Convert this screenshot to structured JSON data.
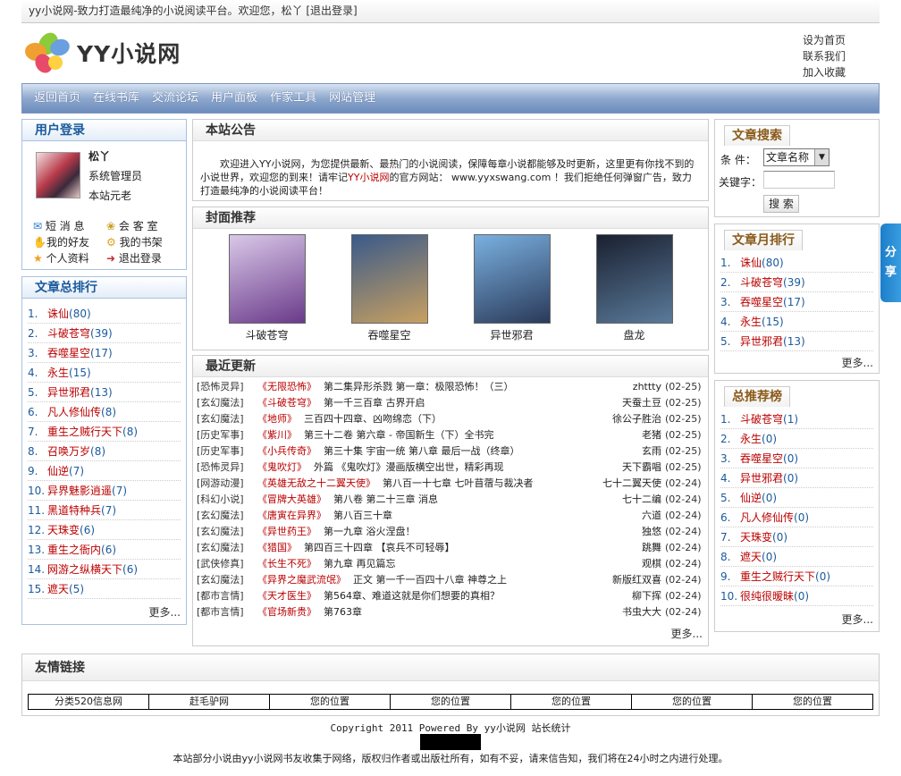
{
  "topbar": {
    "text": "yy小说网-致力打造最纯净的小说阅读平台。欢迎您，松丫 [退出登录]"
  },
  "logo": {
    "text": "YY小说网"
  },
  "toplinks": [
    "设为首页",
    "联系我们",
    "加入收藏"
  ],
  "nav": [
    "返回首页",
    "在线书库",
    "交流论坛",
    "用户面板",
    "作家工具",
    "网站管理"
  ],
  "login": {
    "title": "用户登录",
    "username": "松丫",
    "role": "系统管理员",
    "level": "本站元老",
    "links": [
      "短 消 息",
      "会 客 室",
      "我的好友",
      "我的书架",
      "个人资料",
      "退出登录"
    ]
  },
  "total_rank": {
    "title": "文章总排行",
    "items": [
      {
        "n": "1.",
        "t": "诛仙",
        "c": "(80)"
      },
      {
        "n": "2.",
        "t": "斗破苍穹",
        "c": "(39)"
      },
      {
        "n": "3.",
        "t": "吞噬星空",
        "c": "(17)"
      },
      {
        "n": "4.",
        "t": "永生",
        "c": "(15)"
      },
      {
        "n": "5.",
        "t": "异世邪君",
        "c": "(13)"
      },
      {
        "n": "6.",
        "t": "凡人修仙传",
        "c": "(8)"
      },
      {
        "n": "7.",
        "t": "重生之贼行天下",
        "c": "(8)"
      },
      {
        "n": "8.",
        "t": "召唤万岁",
        "c": "(8)"
      },
      {
        "n": "9.",
        "t": "仙逆",
        "c": "(7)"
      },
      {
        "n": "10.",
        "t": "异界魅影逍遥",
        "c": "(7)"
      },
      {
        "n": "11.",
        "t": "黑道特种兵",
        "c": "(7)"
      },
      {
        "n": "12.",
        "t": "天珠变",
        "c": "(6)"
      },
      {
        "n": "13.",
        "t": "重生之衙内",
        "c": "(6)"
      },
      {
        "n": "14.",
        "t": "网游之纵横天下",
        "c": "(6)"
      },
      {
        "n": "15.",
        "t": "遮天",
        "c": "(5)"
      }
    ],
    "more": "更多..."
  },
  "notice": {
    "title": "本站公告",
    "text_a": "欢迎进入YY小说网，为您提供最新、最热门的小说阅读，保障每章小说都能够及时更新，这里更有你找不到的小说世界，欢迎您的到来！请牢记",
    "text_link": "YY小说网",
    "text_b": "的官方网站： www.yyxswang.com ！我们拒绝任何弹窗广告，致力打造最纯净的小说阅读平台！"
  },
  "covers": {
    "title": "封面推荐",
    "items": [
      {
        "name": "斗破苍穹",
        "c1": "#d9c8e8",
        "c2": "#6a3a8a"
      },
      {
        "name": "吞噬星空",
        "c1": "#3a5a8a",
        "c2": "#c8a060"
      },
      {
        "name": "异世邪君",
        "c1": "#7ab0e0",
        "c2": "#2a3a5a"
      },
      {
        "name": "盘龙",
        "c1": "#1a2030",
        "c2": "#5a7a9a"
      }
    ]
  },
  "updates": {
    "title": "最近更新",
    "items": [
      {
        "cat": "[恐怖灵异]",
        "book": "《无限恐怖》",
        "ch": "第二集异形杀戮 第一章：极限恐怖！（三）",
        "au": "zhttty",
        "dt": "(02-25)"
      },
      {
        "cat": "[玄幻魔法]",
        "book": "《斗破苍穹》",
        "ch": "第一千三百章 古界开启",
        "au": "天蚕土豆",
        "dt": "(02-25)"
      },
      {
        "cat": "[玄幻魔法]",
        "book": "《地师》",
        "ch": "三百四十四章、凶吻绵恋（下）",
        "au": "徐公子胜治",
        "dt": "(02-25)"
      },
      {
        "cat": "[历史军事]",
        "book": "《紫川》",
        "ch": "第三十二卷 第六章 - 帝国新生（下）全书完",
        "au": "老猪",
        "dt": "(02-25)"
      },
      {
        "cat": "[历史军事]",
        "book": "《小兵传奇》",
        "ch": "第三十集 宇宙一统 第八章 最后一战（终章）",
        "au": "玄雨",
        "dt": "(02-25)"
      },
      {
        "cat": "[恐怖灵异]",
        "book": "《鬼吹灯》",
        "ch": "外篇 《鬼吹灯》漫画版横空出世，精彩再现",
        "au": "天下霸唱",
        "dt": "(02-25)"
      },
      {
        "cat": "[网游动漫]",
        "book": "《英雄无敌之十二翼天使》",
        "ch": "第八百一十七章 七叶苜蓿与裁决者",
        "au": "七十二翼天使",
        "dt": "(02-24)"
      },
      {
        "cat": "[科幻小说]",
        "book": "《冒牌大英雄》",
        "ch": "第八卷 第二十三章 消息",
        "au": "七十二编",
        "dt": "(02-24)"
      },
      {
        "cat": "[玄幻魔法]",
        "book": "《唐寅在异界》",
        "ch": "第八百三十章",
        "au": "六道",
        "dt": "(02-24)"
      },
      {
        "cat": "[玄幻魔法]",
        "book": "《异世药王》",
        "ch": "第一九章 浴火涅盘！",
        "au": "独悠",
        "dt": "(02-24)"
      },
      {
        "cat": "[玄幻魔法]",
        "book": "《猎国》",
        "ch": "第四百三十四章 【哀兵不可轻辱】",
        "au": "跳舞",
        "dt": "(02-24)"
      },
      {
        "cat": "[武侠修真]",
        "book": "《长生不死》",
        "ch": "第九章 再见篇忘",
        "au": "观棋",
        "dt": "(02-24)"
      },
      {
        "cat": "[玄幻魔法]",
        "book": "《异界之魔武流氓》",
        "ch": "正文 第一千一百四十八章 神尊之上",
        "au": "新版红双喜",
        "dt": "(02-24)"
      },
      {
        "cat": "[都市言情]",
        "book": "《天才医生》",
        "ch": "第564章、难道这就是你们想要的真相？",
        "au": "柳下挥",
        "dt": "(02-24)"
      },
      {
        "cat": "[都市言情]",
        "book": "《官场新贵》",
        "ch": "第763章",
        "au": "书虫大大",
        "dt": "(02-24)"
      }
    ],
    "more": "更多..."
  },
  "search": {
    "title": "文章搜索",
    "cond_label": "条  件：",
    "select_value": "文章名称",
    "kw_label": "关键字：",
    "kw_value": "",
    "button": "搜 索"
  },
  "month_rank": {
    "title": "文章月排行",
    "items": [
      {
        "n": "1.",
        "t": "诛仙",
        "c": "(80)"
      },
      {
        "n": "2.",
        "t": "斗破苍穹",
        "c": "(39)"
      },
      {
        "n": "3.",
        "t": "吞噬星空",
        "c": "(17)"
      },
      {
        "n": "4.",
        "t": "永生",
        "c": "(15)"
      },
      {
        "n": "5.",
        "t": "异世邪君",
        "c": "(13)"
      }
    ],
    "more": "更多..."
  },
  "recommend": {
    "title": "总推荐榜",
    "items": [
      {
        "n": "1.",
        "t": "斗破苍穹",
        "c": "(1)"
      },
      {
        "n": "2.",
        "t": "永生",
        "c": "(0)"
      },
      {
        "n": "3.",
        "t": "吞噬星空",
        "c": "(0)"
      },
      {
        "n": "4.",
        "t": "异世邪君",
        "c": "(0)"
      },
      {
        "n": "5.",
        "t": "仙逆",
        "c": "(0)"
      },
      {
        "n": "6.",
        "t": "凡人修仙传",
        "c": "(0)"
      },
      {
        "n": "7.",
        "t": "天珠变",
        "c": "(0)"
      },
      {
        "n": "8.",
        "t": "遮天",
        "c": "(0)"
      },
      {
        "n": "9.",
        "t": "重生之贼行天下",
        "c": "(0)"
      },
      {
        "n": "10.",
        "t": "很纯很暧昧",
        "c": "(0)"
      }
    ],
    "more": "更多..."
  },
  "friends": {
    "title": "友情链接",
    "items": [
      "分类520信息网",
      "赶毛驴网",
      "您的位置",
      "您的位置",
      "您的位置",
      "您的位置",
      "您的位置"
    ]
  },
  "share": {
    "text": "分享"
  },
  "footer": {
    "copyright": "Copyright 2011 Powered By yy小说网 站长统计",
    "disclaimer": "本站部分小说由yy小说网书友收集于网络，版权归作者或出版社所有，如有不妥，请来信告知，我们将在24小时之内进行处理。"
  }
}
